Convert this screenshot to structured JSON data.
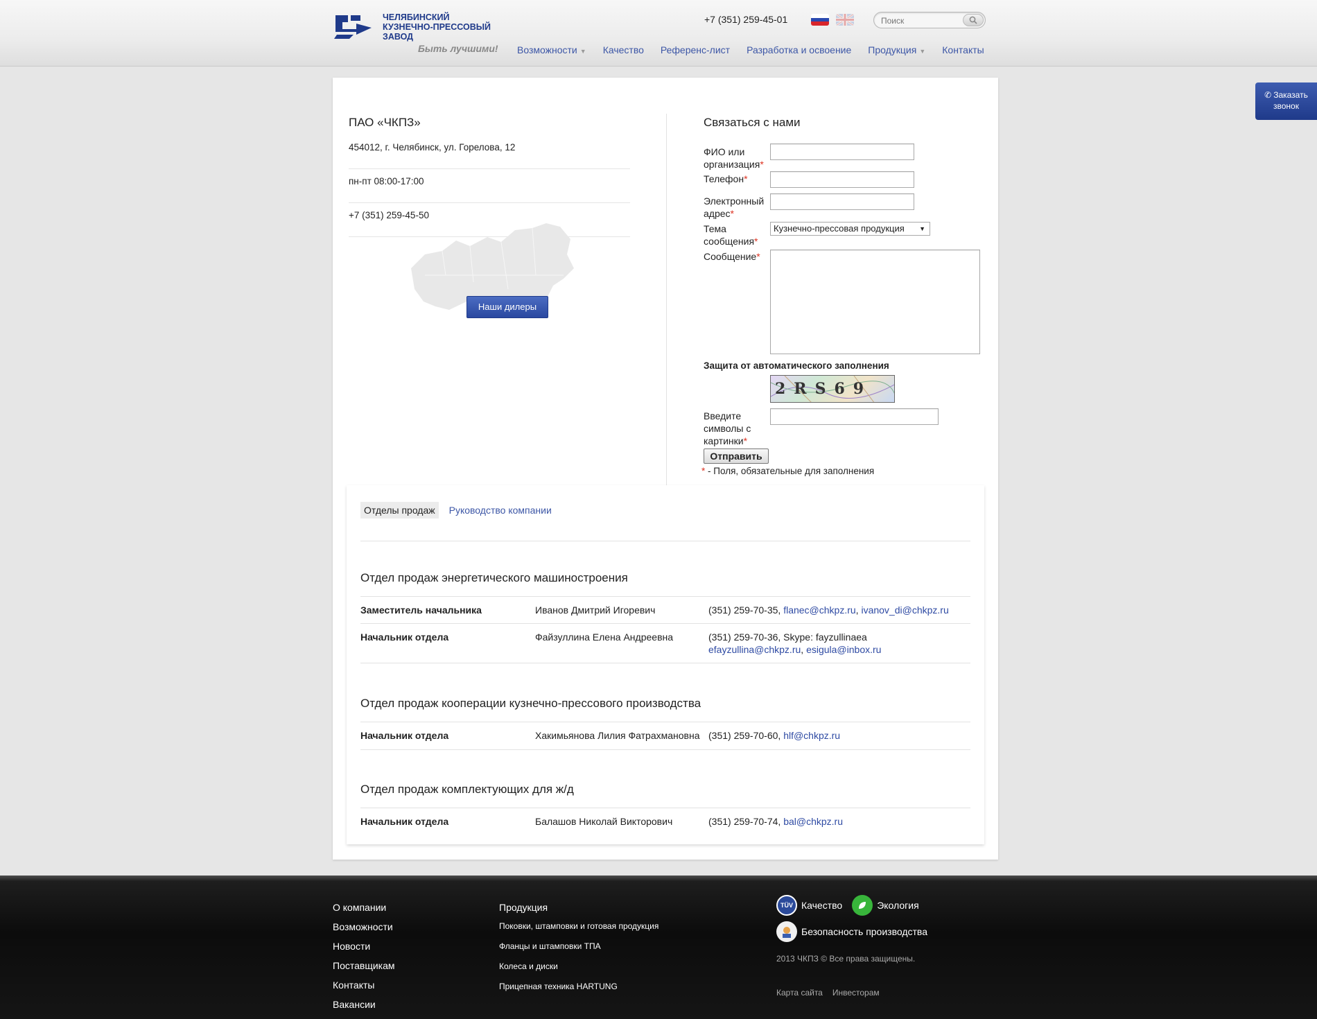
{
  "header": {
    "logo_text": [
      "ЧЕЛЯБИНСКИЙ",
      "КУЗНЕЧНО-ПРЕССОВЫЙ",
      "ЗАВОД"
    ],
    "slogan": "Быть лучшими!",
    "phone": "+7 (351) 259-45-01",
    "search_placeholder": "Поиск",
    "nav": [
      {
        "label": "Возможности",
        "dropdown": true
      },
      {
        "label": "Качество",
        "dropdown": false
      },
      {
        "label": "Референс-лист",
        "dropdown": false
      },
      {
        "label": "Разработка и освоение",
        "dropdown": false
      },
      {
        "label": "Продукция",
        "dropdown": true
      },
      {
        "label": "Контакты",
        "dropdown": false
      }
    ]
  },
  "callback": {
    "line1": "Заказать",
    "line2": "звонок"
  },
  "company": {
    "name": "ПАО «ЧКПЗ»",
    "address": "454012, г. Челябинск, ул. Горелова, 12",
    "hours": "пн-пт 08:00-17:00",
    "phone": "+7 (351) 259-45-50",
    "dealers_button": "Наши дилеры"
  },
  "form": {
    "title": "Связаться с нами",
    "label_name_1": "ФИО или",
    "label_name_2": "организация",
    "label_phone": "Телефон",
    "label_email_1": "Электронный",
    "label_email_2": "адрес",
    "label_topic_1": "Тема",
    "label_topic_2": "сообщения",
    "topic_selected": "Кузнечно-прессовая продукция",
    "label_message": "Сообщение",
    "captcha_title": "Защита от автоматического заполнения",
    "captcha_text": "2RS69",
    "label_captcha_1": "Введите",
    "label_captcha_2": "символы с",
    "label_captcha_3": "картинки",
    "required_mark": "*",
    "submit_label": "Отправить",
    "required_note": "- Поля, обязательные для заполнения"
  },
  "tabs": [
    {
      "label": "Отделы продаж",
      "active": true
    },
    {
      "label": "Руководство компании",
      "active": false
    }
  ],
  "departments": [
    {
      "title": "Отдел продаж энергетического машиностроения",
      "rows": [
        {
          "position": "Заместитель начальника",
          "name": "Иванов Дмитрий Игоревич",
          "phone": "(351) 259-70-35,",
          "line2": "",
          "emails": [
            "flanec@chkpz.ru",
            "ivanov_di@chkpz.ru"
          ]
        },
        {
          "position": "Начальник отдела",
          "name": "Файзуллина Елена Андреевна",
          "phone": "(351) 259-70-36, Skype: fayzullinaea",
          "line2": "",
          "emails": [
            "efayzullina@chkpz.ru",
            "esigula@inbox.ru"
          ]
        }
      ]
    },
    {
      "title": "Отдел продаж кооперации кузнечно-прессового производства",
      "rows": [
        {
          "position": "Начальник отдела",
          "name": "Хакимьянова Лилия Фатрахмановна",
          "phone": "(351) 259-70-60,",
          "emails": [
            "hlf@chkpz.ru"
          ]
        }
      ]
    },
    {
      "title": "Отдел продаж комплектующих для ж/д",
      "rows": [
        {
          "position": "Начальник отдела",
          "name": "Балашов Николай Викторович",
          "phone": "(351) 259-70-74,",
          "emails": [
            "bal@chkpz.ru"
          ]
        }
      ]
    }
  ],
  "footer": {
    "col1": [
      "О компании",
      "Возможности",
      "Новости",
      "Поставщикам",
      "Контакты",
      "Вакансии"
    ],
    "col2_title": "Продукция",
    "col2": [
      "Поковки, штамповки и готовая продукция",
      "Фланцы и штамповки ТПА",
      "Колеса и диски",
      "Прицепная техника HARTUNG"
    ],
    "badges": [
      "Качество",
      "Экология",
      "Безопасность производства"
    ],
    "tuv_label": "TÜV",
    "copyright": "2013 ЧКПЗ © Все права защищены.",
    "links": [
      "Карта сайта",
      "Инвесторам"
    ]
  },
  "colors": {
    "brand": "#1f3a8a",
    "link": "#3c56a6",
    "required": "#dd3322"
  }
}
